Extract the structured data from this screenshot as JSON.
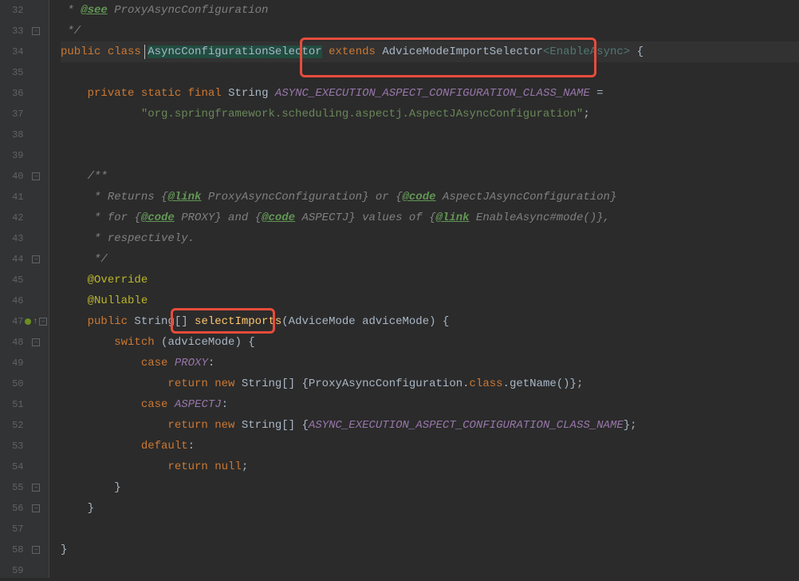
{
  "lines": [
    {
      "num": "32",
      "fold": false
    },
    {
      "num": "33",
      "fold": true
    },
    {
      "num": "34",
      "fold": false
    },
    {
      "num": "35",
      "fold": false
    },
    {
      "num": "36",
      "fold": false
    },
    {
      "num": "37",
      "fold": false
    },
    {
      "num": "38",
      "fold": false
    },
    {
      "num": "39",
      "fold": false
    },
    {
      "num": "40",
      "fold": true
    },
    {
      "num": "41",
      "fold": false
    },
    {
      "num": "42",
      "fold": false
    },
    {
      "num": "43",
      "fold": false
    },
    {
      "num": "44",
      "fold": true
    },
    {
      "num": "45",
      "fold": false
    },
    {
      "num": "46",
      "fold": false
    },
    {
      "num": "47",
      "fold": true,
      "marker": true
    },
    {
      "num": "48",
      "fold": true
    },
    {
      "num": "49",
      "fold": false
    },
    {
      "num": "50",
      "fold": false
    },
    {
      "num": "51",
      "fold": false
    },
    {
      "num": "52",
      "fold": false
    },
    {
      "num": "53",
      "fold": false
    },
    {
      "num": "54",
      "fold": false
    },
    {
      "num": "55",
      "fold": true
    },
    {
      "num": "56",
      "fold": true
    },
    {
      "num": "57",
      "fold": false
    },
    {
      "num": "58",
      "fold": true
    },
    {
      "num": "59",
      "fold": false
    }
  ],
  "code": {
    "l32_see": "@see",
    "l32_text": " ProxyAsyncConfiguration",
    "l33": " */",
    "l34_public": "public",
    "l34_class": "class",
    "l34_name": "AsyncConfigurationSelector",
    "l34_extends": "extends",
    "l34_parent": "AdviceModeImportSelector",
    "l34_lt": "<",
    "l34_generic": "EnableAsync",
    "l34_gt": ">",
    "l34_brace": " {",
    "l36_private": "private",
    "l36_static": "static",
    "l36_final": "final",
    "l36_string": "String",
    "l36_const": "ASYNC_EXECUTION_ASPECT_CONFIGURATION_CLASS_NAME",
    "l36_eq": " =",
    "l37_str": "\"org.springframework.scheduling.aspectj.AspectJAsyncConfiguration\"",
    "l37_semi": ";",
    "l40": "/**",
    "l41_pre": " * Returns {",
    "l41_link": "@link",
    "l41_mid": " ProxyAsyncConfiguration} or {",
    "l41_code": "@code",
    "l41_end": " AspectJAsyncConfiguration}",
    "l42_pre": " * for {",
    "l42_code1": "@code",
    "l42_mid1": " PROXY} and {",
    "l42_code2": "@code",
    "l42_mid2": " ASPECTJ} values of {",
    "l42_link": "@link",
    "l42_end": " EnableAsync#mode()},",
    "l43": " * respectively.",
    "l44": " */",
    "l45": "@Override",
    "l46": "@Nullable",
    "l47_public": "public",
    "l47_type": " String[] ",
    "l47_method": "selectImports",
    "l47_params": "(AdviceMode adviceMode) {",
    "l48_switch": "switch",
    "l48_expr": " (adviceMode) {",
    "l49_case": "case",
    "l49_val": " PROXY",
    "l49_colon": ":",
    "l50_return": "return",
    "l50_new": "new",
    "l50_type": " String[] {ProxyAsyncConfiguration.",
    "l50_class": "class",
    "l50_end": ".getName()};",
    "l51_case": "case",
    "l51_val": " ASPECTJ",
    "l51_colon": ":",
    "l52_return": "return",
    "l52_new": "new",
    "l52_type": " String[] {",
    "l52_const": "ASYNC_EXECUTION_ASPECT_CONFIGURATION_CLASS_NAME",
    "l52_end": "};",
    "l53_default": "default",
    "l53_colon": ":",
    "l54_return": "return",
    "l54_null": "null",
    "l54_semi": ";",
    "l55": "}",
    "l56": "}",
    "l58": "}"
  }
}
